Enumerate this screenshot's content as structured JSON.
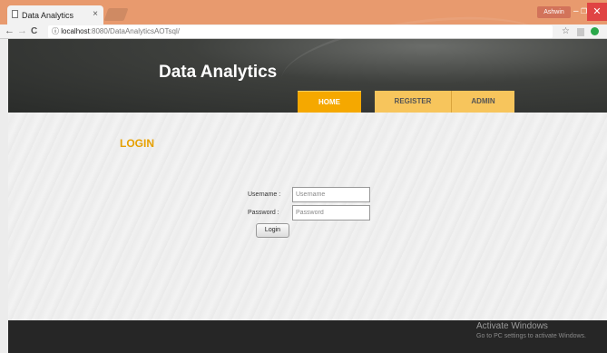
{
  "browser": {
    "tab_title": "Data Analytics",
    "tab_close": "×",
    "profile_label": "Ashwin",
    "url_host": "localhost",
    "url_path": ":8080/DataAnalyticsAOTsql/",
    "info_glyph": "ⓘ",
    "back_glyph": "←",
    "forward_glyph": "→",
    "reload_glyph": "C",
    "star_glyph": "☆",
    "min_glyph": "–",
    "max_glyph": "❐",
    "close_glyph": "✕"
  },
  "site": {
    "brand": "Data Analytics",
    "nav": {
      "home": "HOME",
      "register": "REGISTER",
      "admin": "ADMIN"
    }
  },
  "login": {
    "title": "LOGIN",
    "username_label": "Username :",
    "username_placeholder": "Username",
    "password_label": "Password :",
    "password_placeholder": "Password",
    "button": "Login"
  },
  "watermark": {
    "line1": "Activate Windows",
    "line2": "Go to PC settings to activate Windows."
  },
  "colors": {
    "accent": "#f5a800",
    "title": "#e6a000"
  }
}
